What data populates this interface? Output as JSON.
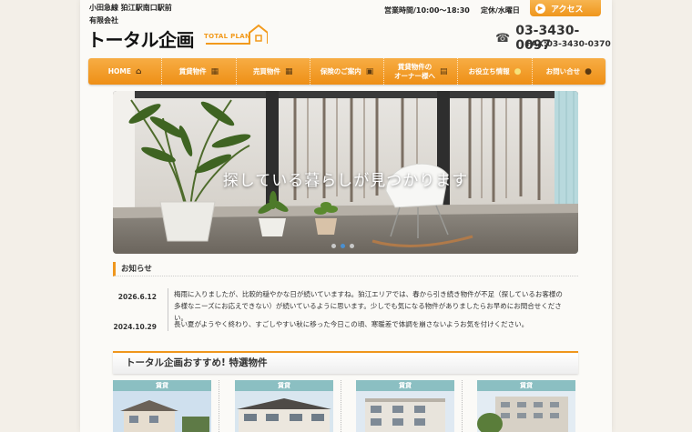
{
  "header": {
    "station": "小田急線 狛江駅南口駅前",
    "company_prefix": "有限会社",
    "company_name": "トータル企画",
    "logo_mark_text": "TOTAL PLAN",
    "hours": "営業時間/10:00〜18:30",
    "holiday": "定休/水曜日",
    "access_label": "アクセス",
    "phone": "03-3430-0097",
    "fax": "FAX:03-3430-0370"
  },
  "nav": {
    "items": [
      {
        "label": "HOME",
        "icon": "home-icon",
        "glyph": "⌂"
      },
      {
        "label": "賃貸物件",
        "icon": "building-icon",
        "glyph": "▦"
      },
      {
        "label": "売買物件",
        "icon": "building-icon",
        "glyph": "▦"
      },
      {
        "label": "保険のご案内",
        "icon": "briefcase-icon",
        "glyph": "▣"
      },
      {
        "label": "賃貸物件の\nオーナー様へ",
        "icon": "document-icon",
        "glyph": "▤"
      },
      {
        "label": "お役立ち情報",
        "icon": "lightbulb-icon",
        "glyph": "●"
      },
      {
        "label": "お問い合せ",
        "icon": "chat-bubble-icon",
        "glyph": "●"
      }
    ]
  },
  "hero": {
    "caption": "探している暮らしが見つかります",
    "slide_count": 3,
    "active_slide": 2
  },
  "news": {
    "title": "お知らせ",
    "items": [
      {
        "date": "2026.6.12",
        "text": "梅雨に入りましたが、比較的穏やかな日が続いていますね。狛江エリアでは、春から引き続き物件が不足（探しているお客様の多様なニーズにお応えできない）が続いているように思います。少しでも気になる物件がありましたらお早めにお問合せください。"
      },
      {
        "date": "2024.10.29",
        "text": "長い夏がようやく終わり、すごしやすい秋に移った今日この頃、寒暖差で体調を崩さないようお気を付けください。"
      }
    ]
  },
  "featured": {
    "title": "トータル企画おすすめ! 特選物件",
    "cards": [
      {
        "tag": "賃貸"
      },
      {
        "tag": "賃貸"
      },
      {
        "tag": "賃貸"
      },
      {
        "tag": "賃貸"
      }
    ]
  },
  "colors": {
    "accent": "#ef961d",
    "tag": "#8bbfc2",
    "slider_active_dot": "#4a8fd0"
  }
}
